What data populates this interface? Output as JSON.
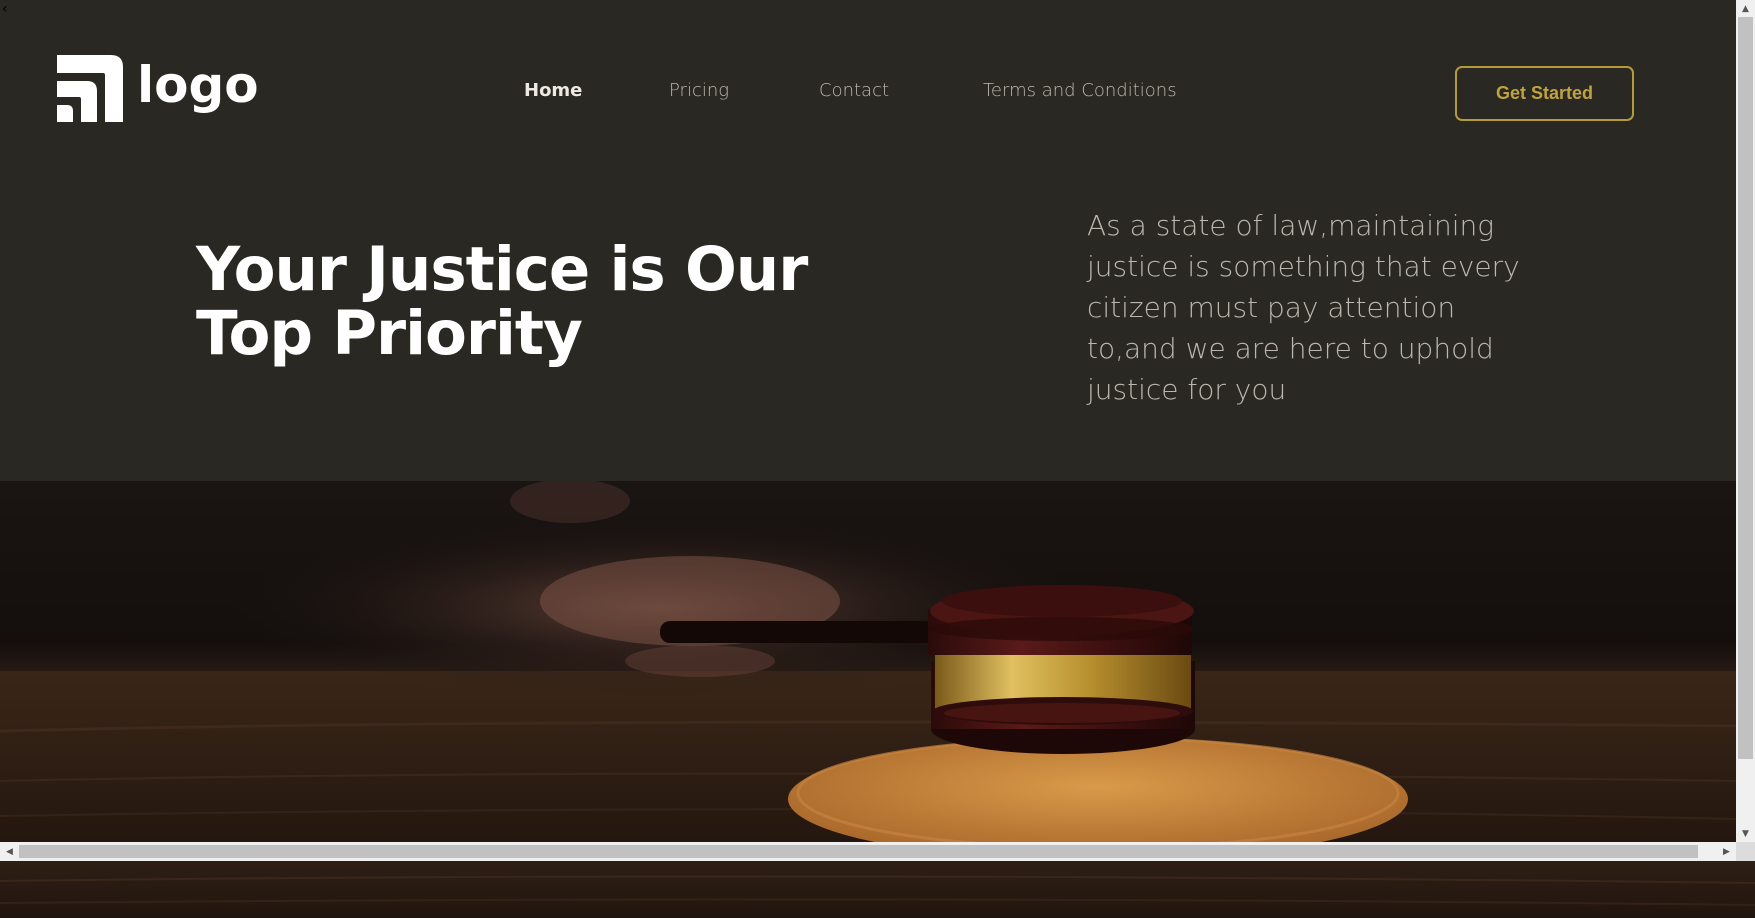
{
  "window": {
    "back_glyph": "‹"
  },
  "brand": {
    "logo_text": "logo",
    "logo_icon": "rss-feed-logo-icon"
  },
  "nav": {
    "items": [
      {
        "label": "Home",
        "active": true
      },
      {
        "label": "Pricing",
        "active": false
      },
      {
        "label": "Contact",
        "active": false
      },
      {
        "label": "Terms and Conditions",
        "active": false
      }
    ]
  },
  "cta": {
    "label": "Get Started"
  },
  "hero": {
    "headline_line1": "Your Justice is Our",
    "headline_line2": "Top Priority",
    "lead": "As a state of law,maintaining justice is something that every citizen must pay attention to,and we are here to uphold justice for you",
    "image": "judge-gavel-photo"
  },
  "scrollbars": {
    "up_icon": "scroll-up-arrow-icon",
    "down_icon": "scroll-down-arrow-icon",
    "left_icon": "scroll-left-arrow-icon",
    "right_icon": "scroll-right-arrow-icon"
  },
  "colors": {
    "header_bg": "#2a2823",
    "accent_gold": "#c0a33f",
    "headline": "#ffffff",
    "lead_text": "#bcb8b0"
  }
}
